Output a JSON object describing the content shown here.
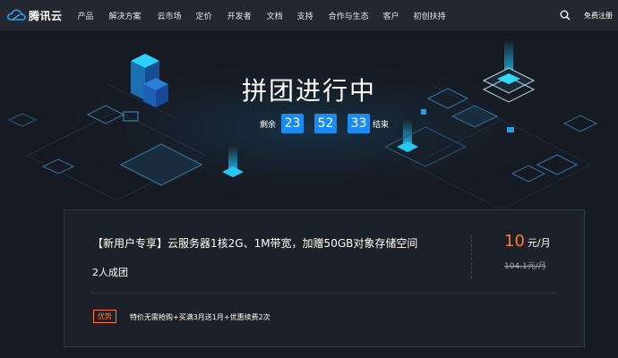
{
  "nav": {
    "logo_text": "腾讯云",
    "items": [
      "产品",
      "解决方案",
      "云市场",
      "定价",
      "开发者",
      "文档",
      "支持",
      "合作与生态",
      "客户",
      "初创扶持"
    ],
    "register": "免费注册"
  },
  "hero": {
    "title": "拼团进行中",
    "countdown": {
      "prefix": "剩余",
      "hours": "23",
      "minutes": "52",
      "seconds": "33",
      "suffix": "结束"
    }
  },
  "card": {
    "title": "【新用户专享】云服务器1核2G、1M带宽，加赠50GB对象存储空间",
    "subtitle": "2人成团",
    "price": "10",
    "price_unit": "元/月",
    "original_price": "104.1元/月",
    "badge": "优势",
    "perk": "特价无需抢购+买满3月送1月+优惠续费2次"
  },
  "colors": {
    "accent_blue": "#1a8cf0",
    "price_orange": "#ff7a3a",
    "nav_bg": "#23272f",
    "page_bg": "#161a22"
  }
}
